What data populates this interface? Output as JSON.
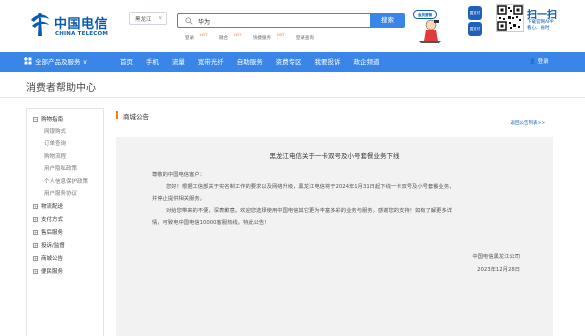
{
  "header": {
    "logo_cn": "中国电信",
    "logo_en": "CHINA TELECOM",
    "province": "黑龙江",
    "search_query": "华为",
    "search_button": "搜索",
    "hot_links": [
      {
        "label": "登录",
        "tag": "HOT"
      },
      {
        "label": "融合",
        "tag": "HOT"
      },
      {
        "label": "快捷服务",
        "tag": "HOT"
      },
      {
        "label": "登录查询",
        "tag": ""
      }
    ],
    "mascot_badge": "会员营销",
    "app_icons": [
      "翼支付",
      "翼支付"
    ],
    "scan_title": "扫一扫",
    "scan_sub_1": "下载官网APP",
    "scan_sub_2": "看心、省时"
  },
  "nav": {
    "all_products": "全部产品及服务",
    "items": [
      "首页",
      "手机",
      "流量",
      "宽带光纤",
      "自助服务",
      "资费专区",
      "我要投诉",
      "政企频道"
    ],
    "login": "登录"
  },
  "page_title": "消费者帮助中心",
  "sidebar": {
    "groups": [
      {
        "label": "购物指南",
        "children": [
          "网银购式",
          "订单查询",
          "购物流程",
          "用户隐私政策",
          "个人信息保护政策",
          "用户服务协议"
        ]
      },
      {
        "label": "物流配送",
        "children": []
      },
      {
        "label": "支付方式",
        "children": []
      },
      {
        "label": "售后服务",
        "children": []
      },
      {
        "label": "投诉/监督",
        "children": []
      },
      {
        "label": "商城公告",
        "children": []
      },
      {
        "label": "便民服务",
        "children": []
      }
    ]
  },
  "main": {
    "section_label": "商城公告",
    "back_link": "返回公告列表>>",
    "article": {
      "title": "黑龙江电信关于一卡双号及小号套餐业务下线",
      "greeting": "尊敬的中国电信客户：",
      "para1_line1": "您好！根据工信部关于实名制工作的要求以及网络升级，黑龙江电信将于2024年1月31日起下线一卡双号及小号套餐业务，",
      "para1_line2": "并停止提供相关服务。",
      "para2_line1": "对给您带来的不便，深表歉意。欢迎您选择使用中国电信其它更为丰富多彩的业务与服务，感谢您的支持！如有了解更多详",
      "para2_line2": "情，可致电中国电信10000客服热线。特此公告！",
      "signer": "中国电信黑龙江公司",
      "date": "2023年12月28日"
    }
  },
  "colors": {
    "brand_blue": "#0a5bb0",
    "nav_blue": "#3a86e8",
    "accent_orange": "#ff7a00",
    "article_bg": "#f2f2f2"
  }
}
